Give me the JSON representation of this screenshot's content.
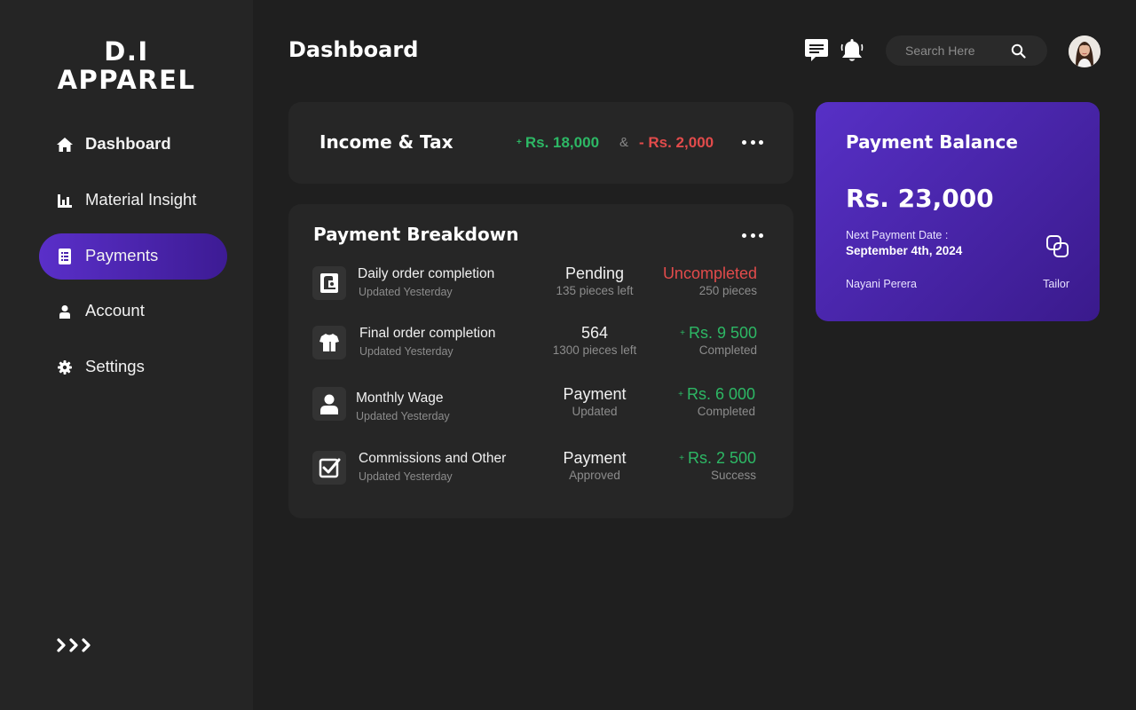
{
  "brand": {
    "line1": "D.I",
    "line2": "APPAREL"
  },
  "sidebar": {
    "items": [
      {
        "label": "Dashboard",
        "icon": "home-icon"
      },
      {
        "label": "Material Insight",
        "icon": "bar-chart-icon"
      },
      {
        "label": "Payments",
        "icon": "receipt-icon",
        "active": true
      },
      {
        "label": "Account",
        "icon": "user-icon"
      },
      {
        "label": "Settings",
        "icon": "gear-icon"
      }
    ],
    "expand_icon": "triple-chevron-right-icon",
    "active_color": "#5a2fc9"
  },
  "header": {
    "title": "Dashboard",
    "search_placeholder": "Search Here",
    "icons": [
      "chat-icon",
      "bell-icon",
      "search-icon"
    ]
  },
  "income": {
    "title": "Income & Tax",
    "income_amount": "Rs. 18,000",
    "amp": "&",
    "tax_amount": "- Rs. 2,000"
  },
  "breakdown": {
    "title": "Payment Breakdown",
    "rows": [
      {
        "icon": "sewing-machine-icon",
        "title": "Daily order completion",
        "sub": "Updated Yesterday",
        "mid1": "Pending",
        "mid2": "135 pieces left",
        "right1": "Uncompleted",
        "right2": "250 pieces",
        "right_status": "negative"
      },
      {
        "icon": "tshirt-icon",
        "title": "Final order completion",
        "sub": "Updated Yesterday",
        "mid1": "564",
        "mid2": "1300 pieces left",
        "right1": "Rs. 9 500",
        "right2": "Completed",
        "right_status": "positive"
      },
      {
        "icon": "person-icon",
        "title": "Monthly Wage",
        "sub": "Updated Yesterday",
        "mid1": "Payment",
        "mid2": "Updated",
        "right1": "Rs. 6 000",
        "right2": "Completed",
        "right_status": "positive"
      },
      {
        "icon": "checkbox-icon",
        "title": "Commissions and Other",
        "sub": "Updated Yesterday",
        "mid1": "Payment",
        "mid2": "Approved",
        "right1": "Rs. 2 500",
        "right2": "Success",
        "right_status": "positive"
      }
    ]
  },
  "balance": {
    "title": "Payment Balance",
    "amount": "Rs. 23,000",
    "next_label": "Next Payment Date :",
    "next_date": "September 4th, 2024",
    "name": "Nayani Perera",
    "role": "Tailor",
    "icon": "copy-icon"
  },
  "colors": {
    "positive": "#2db865",
    "negative": "#e24b4b",
    "accent": "#5730c6"
  }
}
